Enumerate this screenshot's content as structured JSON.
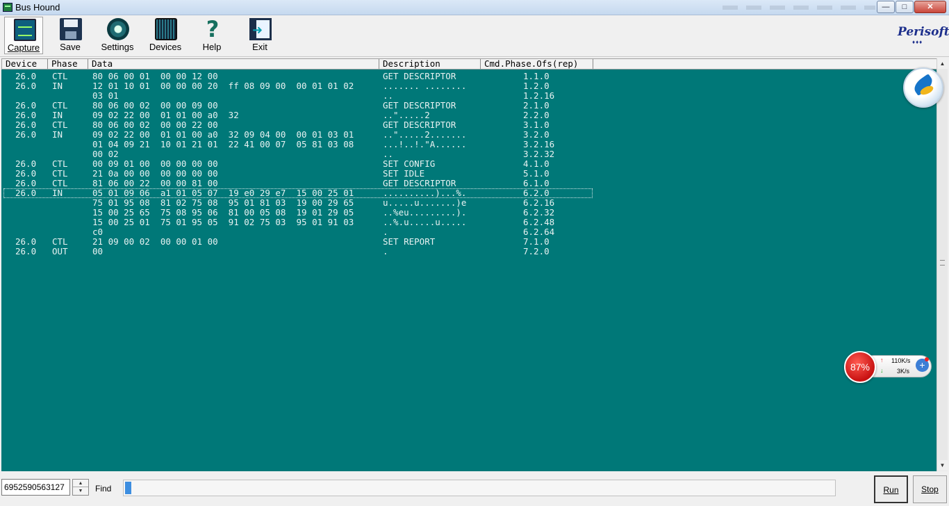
{
  "window": {
    "title": "Bus Hound"
  },
  "toolbar": {
    "capture": "Capture",
    "save": "Save",
    "settings": "Settings",
    "devices": "Devices",
    "help": "Help",
    "exit": "Exit"
  },
  "brand": {
    "name": "Perisoft",
    "dots": "♦♦♦"
  },
  "columns": {
    "device": "Device",
    "phase": "Phase",
    "data": "Data",
    "description": "Description",
    "cmd": "Cmd.Phase.Ofs(rep)"
  },
  "rows": [
    {
      "device": "26.0",
      "phase": "CTL",
      "data": "80 06 00 01  00 00 12 00",
      "desc": "GET DESCRIPTOR",
      "cmd": "1.1.0"
    },
    {
      "device": "26.0",
      "phase": "IN",
      "data": "12 01 10 01  00 00 00 20  ff 08 09 00  00 01 01 02",
      "desc": "....... ........",
      "cmd": "1.2.0"
    },
    {
      "device": "",
      "phase": "",
      "data": "03 01",
      "desc": "..",
      "cmd": "1.2.16"
    },
    {
      "device": "26.0",
      "phase": "CTL",
      "data": "80 06 00 02  00 00 09 00",
      "desc": "GET DESCRIPTOR",
      "cmd": "2.1.0"
    },
    {
      "device": "26.0",
      "phase": "IN",
      "data": "09 02 22 00  01 01 00 a0  32",
      "desc": "..\".....2",
      "cmd": "2.2.0"
    },
    {
      "device": "26.0",
      "phase": "CTL",
      "data": "80 06 00 02  00 00 22 00",
      "desc": "GET DESCRIPTOR",
      "cmd": "3.1.0"
    },
    {
      "device": "26.0",
      "phase": "IN",
      "data": "09 02 22 00  01 01 00 a0  32 09 04 00  00 01 03 01",
      "desc": "..\".....2.......",
      "cmd": "3.2.0"
    },
    {
      "device": "",
      "phase": "",
      "data": "01 04 09 21  10 01 21 01  22 41 00 07  05 81 03 08",
      "desc": "...!..!.\"A......",
      "cmd": "3.2.16"
    },
    {
      "device": "",
      "phase": "",
      "data": "00 02",
      "desc": "..",
      "cmd": "3.2.32"
    },
    {
      "device": "26.0",
      "phase": "CTL",
      "data": "00 09 01 00  00 00 00 00",
      "desc": "SET CONFIG",
      "cmd": "4.1.0"
    },
    {
      "device": "26.0",
      "phase": "CTL",
      "data": "21 0a 00 00  00 00 00 00",
      "desc": "SET IDLE",
      "cmd": "5.1.0"
    },
    {
      "device": "26.0",
      "phase": "CTL",
      "data": "81 06 00 22  00 00 81 00",
      "desc": "GET DESCRIPTOR",
      "cmd": "6.1.0"
    },
    {
      "device": "26.0",
      "phase": "IN",
      "data": "05 01 09 06  a1 01 05 07  19 e0 29 e7  15 00 25 01",
      "desc": "..........)...%.",
      "cmd": "6.2.0"
    },
    {
      "device": "",
      "phase": "",
      "data": "75 01 95 08  81 02 75 08  95 01 81 03  19 00 29 65",
      "desc": "u.....u.......)e",
      "cmd": "6.2.16"
    },
    {
      "device": "",
      "phase": "",
      "data": "15 00 25 65  75 08 95 06  81 00 05 08  19 01 29 05",
      "desc": "..%eu.........).",
      "cmd": "6.2.32"
    },
    {
      "device": "",
      "phase": "",
      "data": "15 00 25 01  75 01 95 05  91 02 75 03  95 01 91 03",
      "desc": "..%.u.....u.....",
      "cmd": "6.2.48"
    },
    {
      "device": "",
      "phase": "",
      "data": "c0",
      "desc": ".",
      "cmd": "6.2.64"
    },
    {
      "device": "26.0",
      "phase": "CTL",
      "data": "21 09 00 02  00 00 01 00",
      "desc": "SET REPORT",
      "cmd": "7.1.0"
    },
    {
      "device": "26.0",
      "phase": "OUT",
      "data": "00",
      "desc": ".",
      "cmd": "7.2.0"
    }
  ],
  "selected_row": 12,
  "net_monitor": {
    "percent": "87%",
    "up": "110K/s",
    "down": "3K/s"
  },
  "bottom": {
    "counter": "6952590563127",
    "find_label": "Find",
    "find_value": "",
    "run": "Run",
    "stop": "Stop"
  }
}
